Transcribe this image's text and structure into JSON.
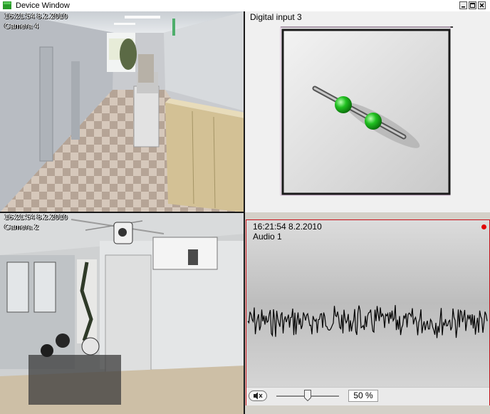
{
  "window": {
    "title": "Device Window"
  },
  "cameras": [
    {
      "timestamp": "16:21:54 8.2.2010",
      "name": "Camera 4"
    },
    {
      "timestamp": "16:21:54 8.2.2010",
      "name": "Camera 2"
    }
  ],
  "digital_input": {
    "label": "Digital input 3",
    "icon": "digital-input-connector-icon"
  },
  "audio": {
    "timestamp": "16:21:54 8.2.2010",
    "name": "Audio 1",
    "recording_indicator_color": "#e00000",
    "volume_percent": 50,
    "volume_label": "50 %",
    "mute_icon": "speaker-muted-icon"
  },
  "colors": {
    "audio_border": "#c8101a",
    "accent_green": "#1fa01f"
  }
}
